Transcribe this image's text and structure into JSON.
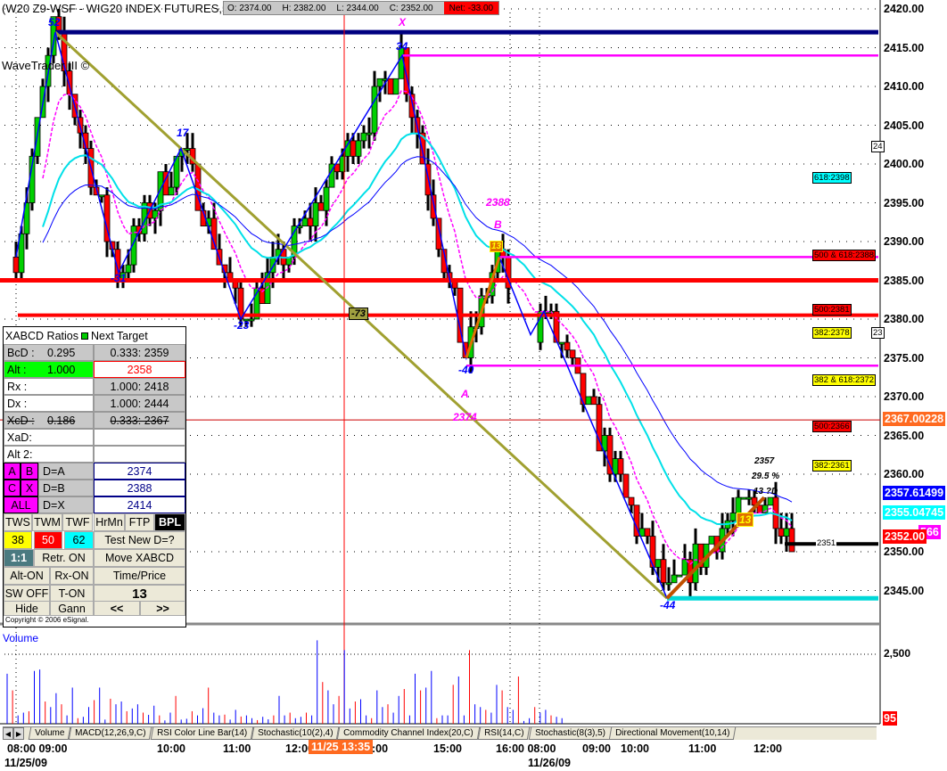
{
  "header": {
    "title": "(W20 Z9-WSF - WIG20 INDEX FUTURES,5) 500 B",
    "open": "O: 2374.00",
    "high": "H: 2382.00",
    "low": "L: 2344.00",
    "close": "C: 2352.00",
    "net": "Net: -33.00",
    "study": "WaveTrader III ©"
  },
  "panel": {
    "title": "XABCD Ratios",
    "title2": "Next Target",
    "rows": [
      {
        "l": "BcD :",
        "lv": "0.295",
        "r": "0.333: 2359"
      },
      {
        "l": "Alt  :",
        "lv": "1.000",
        "r": "2358"
      },
      {
        "l": "Rx   :",
        "lv": "",
        "r": "1.000: 2418"
      },
      {
        "l": "Dx   :",
        "lv": "",
        "r": "1.000: 2444"
      },
      {
        "l": "XcD :",
        "lv": "0.186",
        "r": "0.333: 2367"
      },
      {
        "l": "XaD:",
        "lv": "",
        "r": ""
      },
      {
        "l": "Alt 2:",
        "lv": "",
        "r": ""
      }
    ],
    "a": "A",
    "b": "B",
    "c": "C",
    "x": "X",
    "all": "ALL",
    "da": "D=A",
    "db": "D=B",
    "dx": "D=X",
    "va": "2374",
    "vb": "2388",
    "vx": "2414",
    "btns": {
      "tws": "TWS",
      "twm": "TWM",
      "twf": "TWF",
      "hrmn": "HrMn",
      "ftp": "FTP",
      "bpl": "BPL",
      "b38": "38",
      "b50": "50",
      "b62": "62",
      "test": "Test New D=?",
      "one": "1:1",
      "retr": "Retr. ON",
      "move": "Move XABCD",
      "alt": "Alt-ON",
      "rx": "Rx-ON",
      "tp": "Time/Price",
      "sw": "SW OFF",
      "ton": "T-ON",
      "n13": "13",
      "hide": "Hide",
      "gann": "Gann",
      "prev": "<<",
      "next": ">>"
    },
    "copyright": "Copyright © 2006 eSignal."
  },
  "labels": {
    "p52": "52",
    "p31": "-31",
    "p17": "17",
    "p23": "-23",
    "p34": "34",
    "p40": "-40",
    "p44": "-44",
    "x": "X",
    "b": "B",
    "a": "A",
    "b2388": "2388",
    "a2374": "2374",
    "m73": "-73",
    "t2357": "2357",
    "t295": "29.5 %",
    "t13d": "13 ?D",
    "box13": "13",
    "box13b": "13"
  },
  "right_labels": {
    "l1": "618:2398",
    "l2": "500 & 618:2388",
    "l3": "500:2381",
    "l4": "382:2378",
    "l5": "382 & 618:2372",
    "l6": "500:2366",
    "l7": "382:2361",
    "l8": "2351",
    "l9": "23",
    "l10": "24"
  },
  "axis": {
    "ticks": [
      "2420.00",
      "2415.00",
      "2410.00",
      "2405.00",
      "2400.00",
      "2395.00",
      "2390.00",
      "2385.00",
      "2380.00",
      "2375.00",
      "2370.00",
      "2365.00",
      "2360.00",
      "2355.00",
      "2350.00",
      "2345.00"
    ],
    "tags": {
      "orange": "2367.00228",
      "blue": "2357.61499",
      "cyan": "2355.04745",
      "magenta": "566",
      "red": "2352.00"
    },
    "vol_tick": "2,500",
    "vol_min": "95"
  },
  "volume_title": "Volume",
  "tabs": [
    "Volume",
    "MACD(12,26,9,C)",
    "RSI Color Line Bar(14)",
    "Stochastic(10(2),4)",
    "Commodity Channel Index(20,C)",
    "RSI(14,C)",
    "Stochastic(8(3),5)",
    "Directional Movement(10,14)"
  ],
  "time_axis": {
    "labels": [
      "08:00 09:00",
      "10:00",
      "11:00",
      "12:00",
      "4:00",
      "15:00",
      "16:00 08:00",
      "09:00",
      "10:00",
      "11:00",
      "12:00"
    ],
    "cursor": "11/25 13:35",
    "date1": "11/25/09",
    "date2": "11/26/09"
  },
  "chart_data": {
    "type": "candlestick",
    "ylim": [
      2340,
      2420
    ],
    "waypoints": [
      [
        0,
        2388
      ],
      [
        7,
        2417
      ],
      [
        19,
        2386
      ],
      [
        31,
        2402
      ],
      [
        42,
        2380
      ],
      [
        55,
        2393
      ],
      [
        72,
        2414
      ],
      [
        84,
        2375
      ],
      [
        90,
        2388
      ],
      [
        96,
        2378
      ],
      [
        99,
        2381
      ],
      [
        122,
        2344
      ],
      [
        130,
        2352
      ],
      [
        140,
        2357
      ],
      [
        145,
        2352
      ]
    ],
    "volume": [
      1800,
      1200,
      300,
      400,
      450,
      1900,
      1950,
      800,
      600,
      1100,
      700,
      300,
      1300,
      200,
      250,
      600,
      850,
      1300,
      150,
      900,
      700,
      800,
      450,
      550,
      700,
      400,
      320,
      650,
      300,
      120,
      400,
      1000,
      150,
      180,
      450,
      300,
      560,
      1300,
      400,
      300,
      330,
      150,
      500,
      260,
      300,
      200,
      130,
      250,
      160,
      300,
      1000,
      300,
      400,
      200,
      250,
      400,
      300,
      3000,
      1500,
      1200,
      700,
      1000,
      2650,
      550,
      800,
      880,
      300,
      200,
      1200,
      600,
      700,
      400,
      1000,
      1250,
      300,
      1800,
      1200,
      1300,
      1900,
      200,
      300,
      300,
      1400,
      1700,
      300,
      2650,
      700,
      600,
      500,
      400,
      1400,
      1200,
      600,
      500,
      1700,
      100,
      200,
      600,
      400,
      500,
      300,
      250,
      200
    ],
    "colors": {
      "up": "#00d000",
      "down": "#ff0000",
      "ema_fast": "#ff00ff",
      "ema_mid": "#00e0e8",
      "ema_slow": "#0000ff"
    }
  }
}
